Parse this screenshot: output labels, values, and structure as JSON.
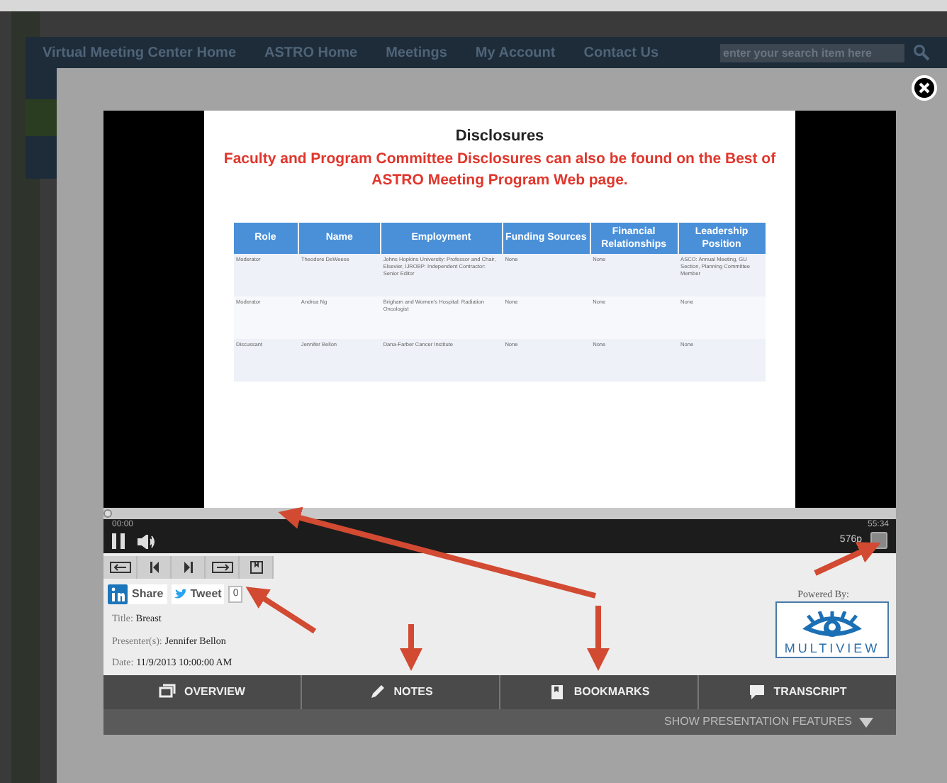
{
  "nav": {
    "items": [
      "Virtual Meeting Center Home",
      "ASTRO Home",
      "Meetings",
      "My Account",
      "Contact Us"
    ],
    "search": {
      "placeholder": "enter your search item here"
    }
  },
  "slide": {
    "title": "Disclosures",
    "subtitle": "Faculty and Program Committee Disclosures can also be found on the Best of ASTRO Meeting Program Web page.",
    "columns": [
      "Role",
      "Name",
      "Employment",
      "Funding Sources",
      "Financial Relationships",
      "Leadership Position"
    ],
    "rows": [
      [
        "Moderator",
        "Theodore DeWeese",
        "Johns Hopkins University: Professor and Chair, Elsevier, IJROBP: Independent Contractor: Senior Editor",
        "None",
        "None",
        "ASCO: Annual Meeting, GU Section, Planning Committee Member"
      ],
      [
        "Moderator",
        "Andrea Ng",
        "Brigham and Women's Hospital: Radiation Oncologist",
        "None",
        "None",
        "None"
      ],
      [
        "Discussant",
        "Jennifer Bellon",
        "Dana-Farber Cancer Institute",
        "None",
        "None",
        "None"
      ]
    ]
  },
  "player": {
    "progress": {
      "level": 0
    },
    "time_elapsed": "00:00",
    "time_total": "55:34",
    "quality": "576p"
  },
  "toolbar": [
    {
      "kind": "back"
    },
    {
      "kind": "prev"
    },
    {
      "kind": "next"
    },
    {
      "kind": "forward"
    },
    {
      "kind": "bookmark"
    }
  ],
  "share": {
    "linkedin": "Share",
    "twitter": "Tweet",
    "count": "0"
  },
  "meta": [
    {
      "label": "Title:",
      "value": "Breast"
    },
    {
      "label": "Presenter(s):",
      "value": "Jennifer Bellon"
    },
    {
      "label": "Date:",
      "value": "11/9/2013 10:00:00 AM"
    }
  ],
  "powered_by": {
    "label": "Powered By:",
    "logo": "MULTIVIEW"
  },
  "tabs": [
    {
      "label": "OVERVIEW",
      "kind": "overview"
    },
    {
      "label": "NOTES",
      "kind": "notes"
    },
    {
      "label": "BOOKMARKS",
      "kind": "bookmarks"
    },
    {
      "label": "TRANSCRIPT",
      "kind": "transcript"
    }
  ],
  "features_toggle": "SHOW PRESENTATION FEATURES"
}
